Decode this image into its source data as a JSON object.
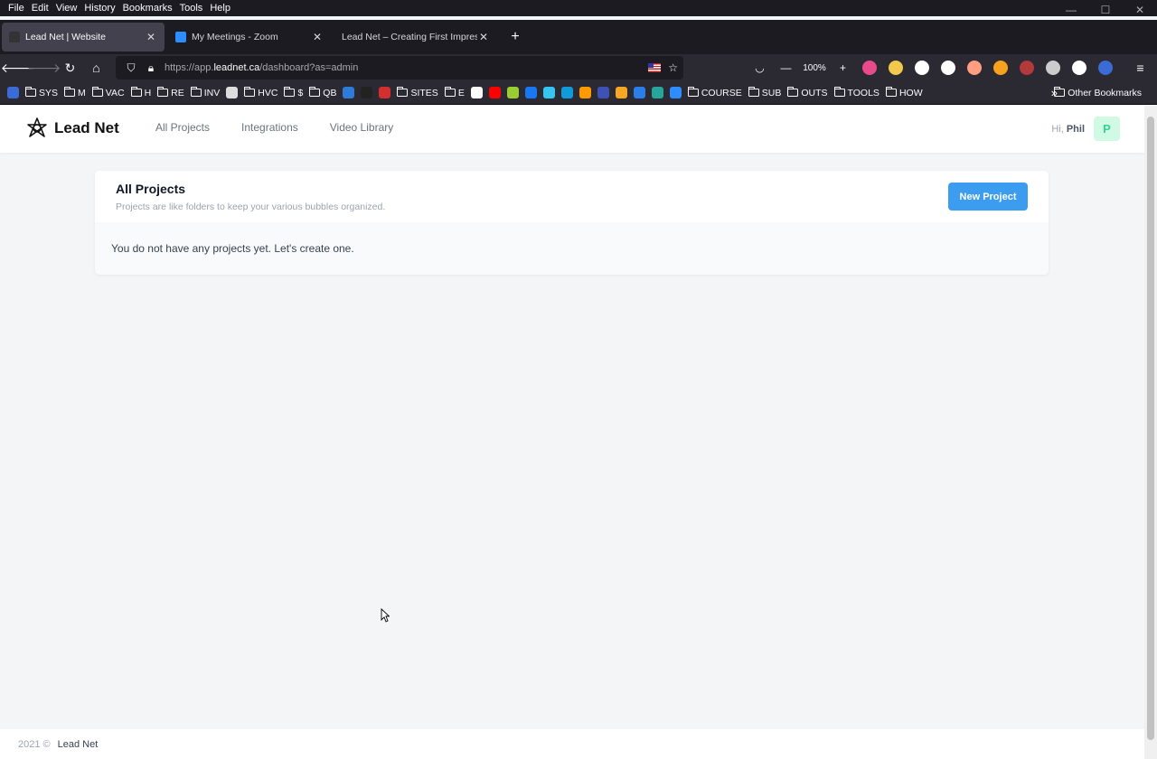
{
  "browser": {
    "menu": [
      "File",
      "Edit",
      "View",
      "History",
      "Bookmarks",
      "Tools",
      "Help"
    ],
    "tabs": [
      {
        "title": "Lead Net | Website",
        "icon_color": "#333333",
        "active": true
      },
      {
        "title": "My Meetings - Zoom",
        "icon_color": "#2d8cff",
        "active": false
      },
      {
        "title": "Lead Net – Creating First Impression",
        "icon_color": "#1c1b22",
        "active": false
      }
    ],
    "url_prefix": "https://app.",
    "url_domain": "leadnet.ca",
    "url_suffix": "/dashboard?as=admin",
    "zoom": "100%",
    "bookmarks": [
      {
        "label": "",
        "type": "icon",
        "color": "#3b6bd6"
      },
      {
        "label": "SYS",
        "type": "folder"
      },
      {
        "label": "M",
        "type": "folder"
      },
      {
        "label": "VAC",
        "type": "folder"
      },
      {
        "label": "H",
        "type": "folder"
      },
      {
        "label": "RE",
        "type": "folder"
      },
      {
        "label": "INV",
        "type": "folder"
      },
      {
        "label": "",
        "type": "icon",
        "color": "#dddddd"
      },
      {
        "label": "HVC",
        "type": "folder"
      },
      {
        "label": "$",
        "type": "folder"
      },
      {
        "label": "QB",
        "type": "folder"
      },
      {
        "label": "",
        "type": "icon",
        "color": "#2f7bd9"
      },
      {
        "label": "",
        "type": "icon",
        "color": "#222222"
      },
      {
        "label": "",
        "type": "icon",
        "color": "#d32f2f"
      },
      {
        "label": "SITES",
        "type": "folder"
      },
      {
        "label": "E",
        "type": "folder"
      },
      {
        "label": "",
        "type": "icon",
        "color": "#ffffff"
      },
      {
        "label": "",
        "type": "icon",
        "color": "#ff0000"
      },
      {
        "label": "",
        "type": "icon",
        "color": "#9acd32"
      },
      {
        "label": "",
        "type": "icon",
        "color": "#1877f2"
      },
      {
        "label": "",
        "type": "icon",
        "color": "#36c5f0"
      },
      {
        "label": "",
        "type": "icon",
        "color": "#0f9bd7"
      },
      {
        "label": "",
        "type": "icon",
        "color": "#ff9900"
      },
      {
        "label": "",
        "type": "icon",
        "color": "#4051b5"
      },
      {
        "label": "",
        "type": "icon",
        "color": "#f5a623"
      },
      {
        "label": "",
        "type": "icon",
        "color": "#2b7de9"
      },
      {
        "label": "",
        "type": "icon",
        "color": "#26a69a"
      },
      {
        "label": "",
        "type": "icon",
        "color": "#2d8cff"
      },
      {
        "label": "COURSE",
        "type": "folder"
      },
      {
        "label": "SUB",
        "type": "folder"
      },
      {
        "label": "OUTS",
        "type": "folder"
      },
      {
        "label": "TOOLS",
        "type": "folder"
      },
      {
        "label": "HOW",
        "type": "folder"
      }
    ],
    "other_bookmarks": "Other Bookmarks",
    "extensions": [
      "#e94b8a",
      "#f2c94c",
      "#ffffff",
      "#ffffff",
      "#ff9e80",
      "#f6a21d",
      "#b33a3a",
      "#cccccc",
      "#ffffff",
      "#3b6bd6"
    ]
  },
  "app": {
    "brand": "Lead Net",
    "nav": [
      "All Projects",
      "Integrations",
      "Video Library"
    ],
    "greeting_prefix": "Hi, ",
    "user_name": "Phil",
    "avatar_letter": "P"
  },
  "projects": {
    "title": "All Projects",
    "subtitle": "Projects are like folders to keep your various bubbles organized.",
    "new_button": "New Project",
    "empty_message": "You do not have any projects yet. Let's create one."
  },
  "footer": {
    "copyright": "2021 ©",
    "brand": "Lead Net"
  }
}
